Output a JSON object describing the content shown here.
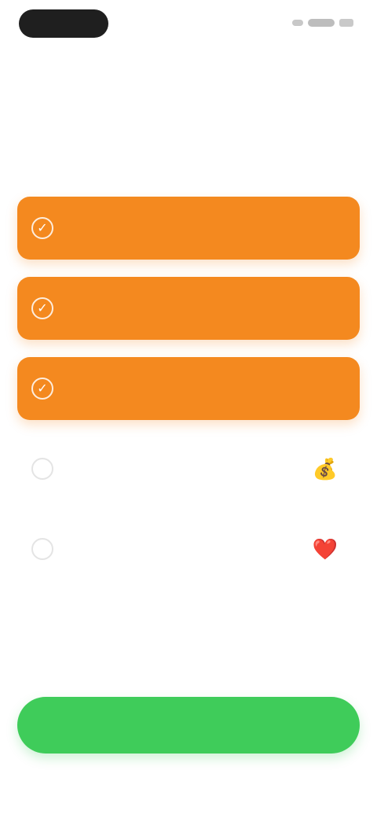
{
  "header": {
    "title": "",
    "subtitle": ""
  },
  "options": [
    {
      "label": "",
      "emoji": "",
      "selected": true
    },
    {
      "label": "",
      "emoji": "",
      "selected": true
    },
    {
      "label": "",
      "emoji": "",
      "selected": true
    },
    {
      "label": "",
      "emoji": "💰",
      "selected": false
    },
    {
      "label": "",
      "emoji": "❤️",
      "selected": false
    }
  ],
  "continue_button": {
    "label": ""
  },
  "colors": {
    "accent": "#f4891f",
    "primary_button": "#3fcc5a",
    "background": "#ffffff"
  },
  "icons": {
    "check": "✓"
  }
}
